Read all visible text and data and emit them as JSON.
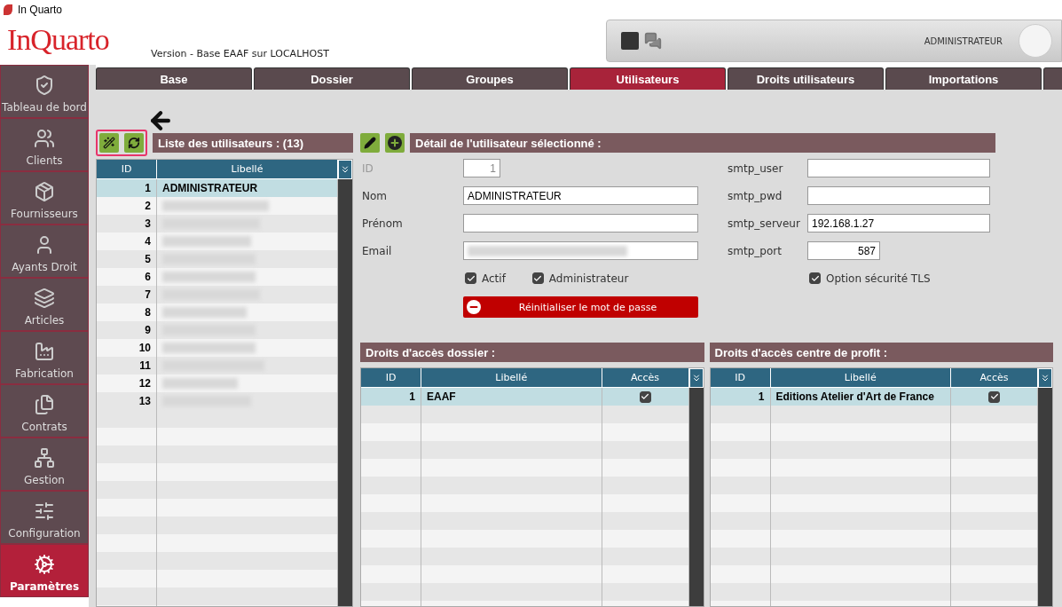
{
  "window": {
    "title": "In Quarto"
  },
  "header": {
    "logo": "InQuarto",
    "version": "Version  - Base EAAF sur LOCALHOST",
    "user": "ADMINISTRATEUR"
  },
  "sidebar": {
    "items": [
      {
        "label": "Tableau de bord",
        "selected": false
      },
      {
        "label": "Clients",
        "selected": false
      },
      {
        "label": "Fournisseurs",
        "selected": false
      },
      {
        "label": "Ayants Droit",
        "selected": false
      },
      {
        "label": "Articles",
        "selected": false
      },
      {
        "label": "Fabrication",
        "selected": false
      },
      {
        "label": "Contrats",
        "selected": false
      },
      {
        "label": "Gestion",
        "selected": false
      },
      {
        "label": "Configuration",
        "selected": false
      },
      {
        "label": "Paramètres",
        "selected": true
      }
    ]
  },
  "tabs": [
    {
      "label": "Base",
      "selected": false
    },
    {
      "label": "Dossier",
      "selected": false
    },
    {
      "label": "Groupes",
      "selected": false
    },
    {
      "label": "Utilisateurs",
      "selected": true
    },
    {
      "label": "Droits utilisateurs",
      "selected": false
    },
    {
      "label": "Importations",
      "selected": false
    }
  ],
  "users_list": {
    "title": "Liste des utilisateurs : (13)",
    "columns": [
      "ID",
      "Libellé"
    ],
    "rows": [
      {
        "id": "1",
        "label": "ADMINISTRATEUR",
        "blurred": false,
        "selected": true
      },
      {
        "id": "2",
        "blurred": true,
        "selected": false
      },
      {
        "id": "3",
        "blurred": true,
        "selected": false
      },
      {
        "id": "4",
        "blurred": true,
        "selected": false
      },
      {
        "id": "5",
        "blurred": true,
        "selected": false
      },
      {
        "id": "6",
        "blurred": true,
        "selected": false
      },
      {
        "id": "7",
        "blurred": true,
        "selected": false
      },
      {
        "id": "8",
        "blurred": true,
        "selected": false
      },
      {
        "id": "9",
        "blurred": true,
        "selected": false
      },
      {
        "id": "10",
        "blurred": true,
        "selected": false
      },
      {
        "id": "11",
        "blurred": true,
        "selected": false
      },
      {
        "id": "12",
        "blurred": true,
        "selected": false
      },
      {
        "id": "13",
        "blurred": true,
        "selected": false
      }
    ]
  },
  "detail": {
    "title": "Détail de l'utilisateur sélectionné :",
    "left_fields": [
      {
        "label": "ID",
        "value": "1",
        "kind": "short",
        "disabled": true
      },
      {
        "label": "Nom",
        "value": "ADMINISTRATEUR",
        "kind": "wide",
        "disabled": false
      },
      {
        "label": "Prénom",
        "kind": "wide",
        "disabled": false
      },
      {
        "label": "Email",
        "kind": "blurred",
        "disabled": false
      }
    ],
    "checkboxes": [
      {
        "label": "Actif",
        "checked": true
      },
      {
        "label": "Administrateur",
        "checked": true
      }
    ],
    "reset_button": "Réinitialiser le mot de passe",
    "right_fields": [
      {
        "label": "smtp_user",
        "kind": "wide"
      },
      {
        "label": "smtp_pwd",
        "kind": "wide"
      },
      {
        "label": "smtp_serveur",
        "value": "192.168.1.27",
        "kind": "wide"
      },
      {
        "label": "smtp_port",
        "value": "587",
        "kind": "short"
      }
    ],
    "tls": {
      "label": "Option sécurité TLS",
      "checked": true
    }
  },
  "access_tables": [
    {
      "title": "Droits d'accès dossier :",
      "columns": [
        "ID",
        "Libellé",
        "Accès"
      ],
      "rows": [
        {
          "id": "1",
          "label": "EAAF",
          "access": true,
          "selected": true
        }
      ]
    },
    {
      "title": "Droits d'accès centre de profit :",
      "columns": [
        "ID",
        "Libellé",
        "Accès"
      ],
      "rows": [
        {
          "id": "1",
          "label": "Editions Atelier d'Art de France",
          "access": true,
          "selected": true
        }
      ]
    }
  ]
}
